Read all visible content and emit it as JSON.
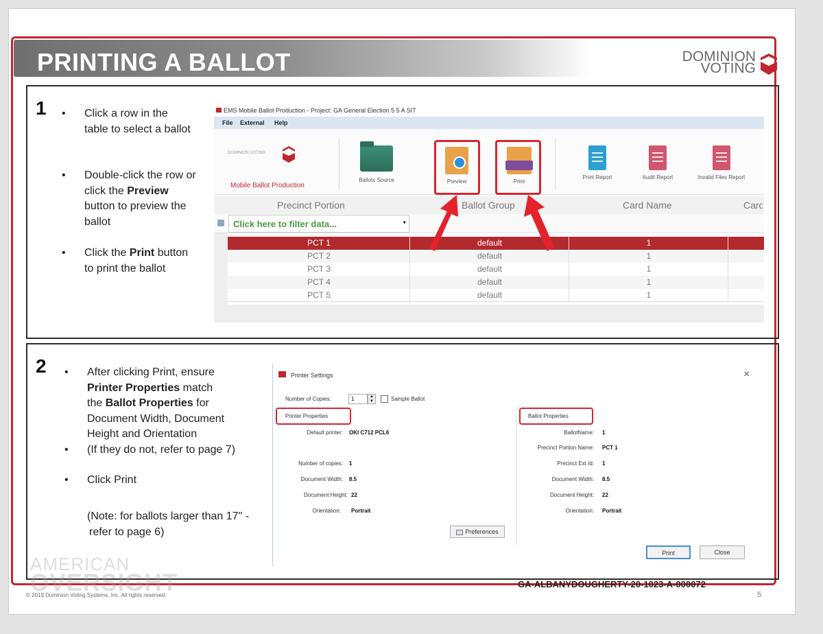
{
  "header": {
    "title": "PRINTING A BALLOT",
    "brand_line1": "DOMINION",
    "brand_line2": "VOTING"
  },
  "step1": {
    "number": "1",
    "bullets": [
      {
        "text": "Click a row in the table to select a ballot"
      },
      {
        "pre": "Double-click the row or click the ",
        "bold": "Preview",
        "post": " button to preview the ballot"
      },
      {
        "pre": "Click the ",
        "bold": "Print",
        "post": " button to print the ballot"
      }
    ],
    "app": {
      "title": "EMS Mobile Ballot Production - Project: GA General Election 5 5 A SIT",
      "menu": [
        "File",
        "External",
        "Help"
      ],
      "logo_text": "DOMINION VOTING",
      "product_label": "Mobile Ballot Production",
      "tools": [
        "Ballots Source",
        "Preview",
        "Print",
        "Print Report",
        "Audit Report",
        "Invalid Files Report"
      ],
      "columns": [
        "Precinct Portion",
        "Ballot Group",
        "Card Name",
        "Card"
      ],
      "filter_placeholder": "Click here to filter data...",
      "rows": [
        {
          "precinct": "PCT 1",
          "group": "default",
          "card": "1"
        },
        {
          "precinct": "PCT 2",
          "group": "default",
          "card": "1"
        },
        {
          "precinct": "PCT 3",
          "group": "default",
          "card": "1"
        },
        {
          "precinct": "PCT 4",
          "group": "default",
          "card": "1"
        },
        {
          "precinct": "PCT 5",
          "group": "default",
          "card": "1"
        }
      ],
      "selected_row_color": "#b22a2e"
    }
  },
  "step2": {
    "number": "2",
    "bullets": [
      {
        "l1": "After clicking Print, ensure",
        "l2b": "Printer Properties",
        "l2": " match",
        "l3a": "the ",
        "l3b": "Ballot Properties",
        "l3": " for",
        "l4": "Document Width, Document",
        "l5": "Height and Orientation"
      },
      {
        "text": "(If they do not, refer to page 7)"
      },
      {
        "text": "Click Print"
      }
    ],
    "note_line1": "(Note: for ballots larger than 17\" -",
    "note_line2": "refer to page 6)",
    "dialog": {
      "title": "Printer Settings",
      "close": "×",
      "copies_label": "Number  of Copies:",
      "copies_value": "1",
      "sample_label": "Sample Ballot",
      "printer_properties": "Printer Properties",
      "ballot_properties": "Ballot Properties",
      "printer_fields": [
        {
          "label": "Default printer:",
          "value": "OKI C712 PCL6"
        },
        {
          "label": "Number of copies:",
          "value": "1"
        },
        {
          "label": "Document Width:",
          "value": "8.5"
        },
        {
          "label": "Document Height:",
          "value": "22"
        },
        {
          "label": "Orientation:",
          "value": "Portrait"
        }
      ],
      "ballot_fields": [
        {
          "label": "BallotName:",
          "value": "1"
        },
        {
          "label": "Precinct Portion Name:",
          "value": "PCT 1"
        },
        {
          "label": "Precinct Ext Id:",
          "value": "1"
        },
        {
          "label": "Document Width:",
          "value": "8.5"
        },
        {
          "label": "Document Height:",
          "value": "22"
        },
        {
          "label": "Orientation:",
          "value": "Portrait"
        }
      ],
      "preferences_button": "Preferences",
      "print_button": "Print",
      "close_button": "Close"
    }
  },
  "footer": {
    "copyright": "© 2019 Dominion Voting Systems, Inc. All rights reserved.",
    "page_number": "5",
    "doc_id": "GA-ALBANYDOUGHERTY-20-1023-A-000072",
    "watermark_line1": "AMERICAN",
    "watermark_line2": "OVERSIGHT"
  },
  "colors": {
    "accent": "#c2262e",
    "highlight": "#d62631"
  }
}
